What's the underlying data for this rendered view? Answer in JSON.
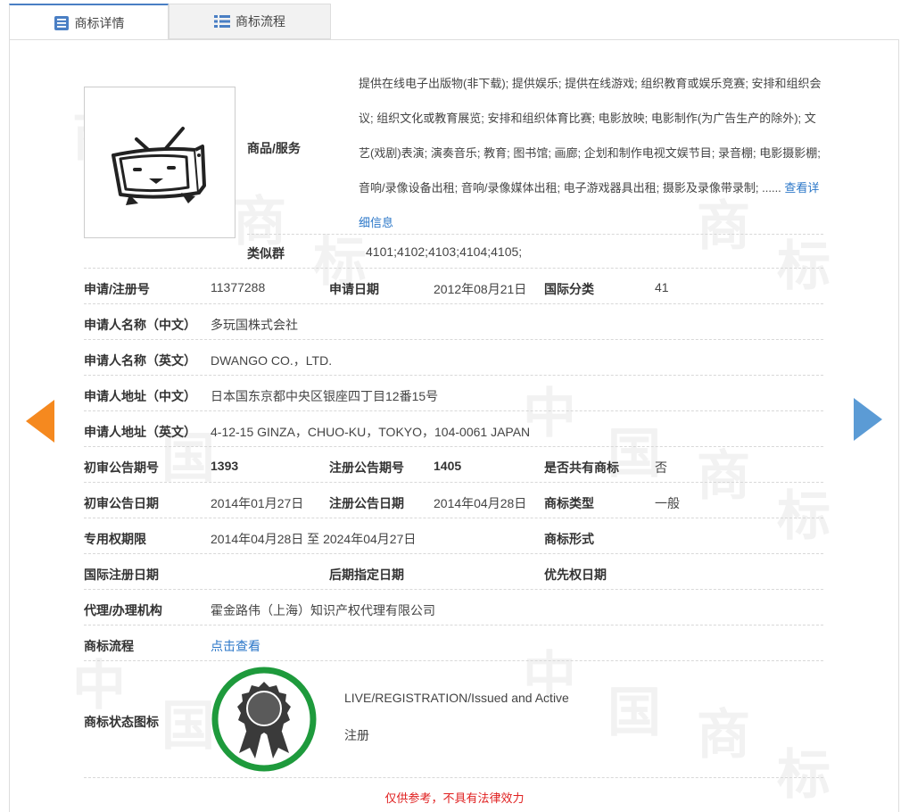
{
  "tabs": [
    {
      "label": "商标详情",
      "active": true
    },
    {
      "label": "商标流程",
      "active": false
    }
  ],
  "watermark": {
    "chars": [
      "商",
      "标",
      "中",
      "国"
    ]
  },
  "goods": {
    "label": "商品/服务",
    "text": "提供在线电子出版物(非下载); 提供娱乐; 提供在线游戏; 组织教育或娱乐竞赛; 安排和组织会议; 组织文化或教育展览; 安排和组织体育比赛; 电影放映; 电影制作(为广告生产的除外); 文艺(戏剧)表演; 演奏音乐; 教育; 图书馆; 画廊; 企划和制作电视文娱节目; 录音棚; 电影摄影棚; 音响/录像设备出租; 音响/录像媒体出租; 电子游戏器具出租; 摄影及录像带录制; ......",
    "detail_link": "查看详细信息"
  },
  "similar_group": {
    "label": "类似群",
    "value": "4101;4102;4103;4104;4105;"
  },
  "rows": {
    "app_no_label": "申请/注册号",
    "app_no": "11377288",
    "app_date_label": "申请日期",
    "app_date": "2012年08月21日",
    "intl_class_label": "国际分类",
    "intl_class": "41",
    "applicant_cn_label": "申请人名称（中文）",
    "applicant_cn": "多玩国株式会社",
    "applicant_en_label": "申请人名称（英文）",
    "applicant_en": "DWANGO CO.，LTD.",
    "address_cn_label": "申请人地址（中文）",
    "address_cn": "日本国东京都中央区银座四丁目12番15号",
    "address_en_label": "申请人地址（英文）",
    "address_en": "4-12-15 GINZA，CHUO-KU，TOKYO，104-0061 JAPAN",
    "prelim_no_label": "初审公告期号",
    "prelim_no": "1393",
    "reg_no_label": "注册公告期号",
    "reg_no": "1405",
    "shared_label": "是否共有商标",
    "shared": "否",
    "prelim_date_label": "初审公告日期",
    "prelim_date": "2014年01月27日",
    "reg_date_label": "注册公告日期",
    "reg_date": "2014年04月28日",
    "tm_type_label": "商标类型",
    "tm_type": "一般",
    "exclusive_label": "专用权期限",
    "exclusive": "2014年04月28日 至 2024年04月27日",
    "tm_form_label": "商标形式",
    "tm_form": "",
    "intl_reg_date_label": "国际注册日期",
    "intl_reg_date": "",
    "later_date_label": "后期指定日期",
    "later_date": "",
    "priority_label": "优先权日期",
    "priority": "",
    "agent_label": "代理/办理机构",
    "agent": "霍金路伟（上海）知识产权代理有限公司",
    "process_label": "商标流程",
    "process_link": "点击查看",
    "status_label": "商标状态图标",
    "status_en": "LIVE/REGISTRATION/Issued and Active",
    "status_cn": "注册"
  },
  "footer": "仅供参考，不具有法律效力",
  "colors": {
    "accent": "#2b77c8",
    "prev_arrow": "#f5891f",
    "next_arrow": "#5b9bd5",
    "badge_ring": "#1e9a3c",
    "footer": "#e02020"
  }
}
